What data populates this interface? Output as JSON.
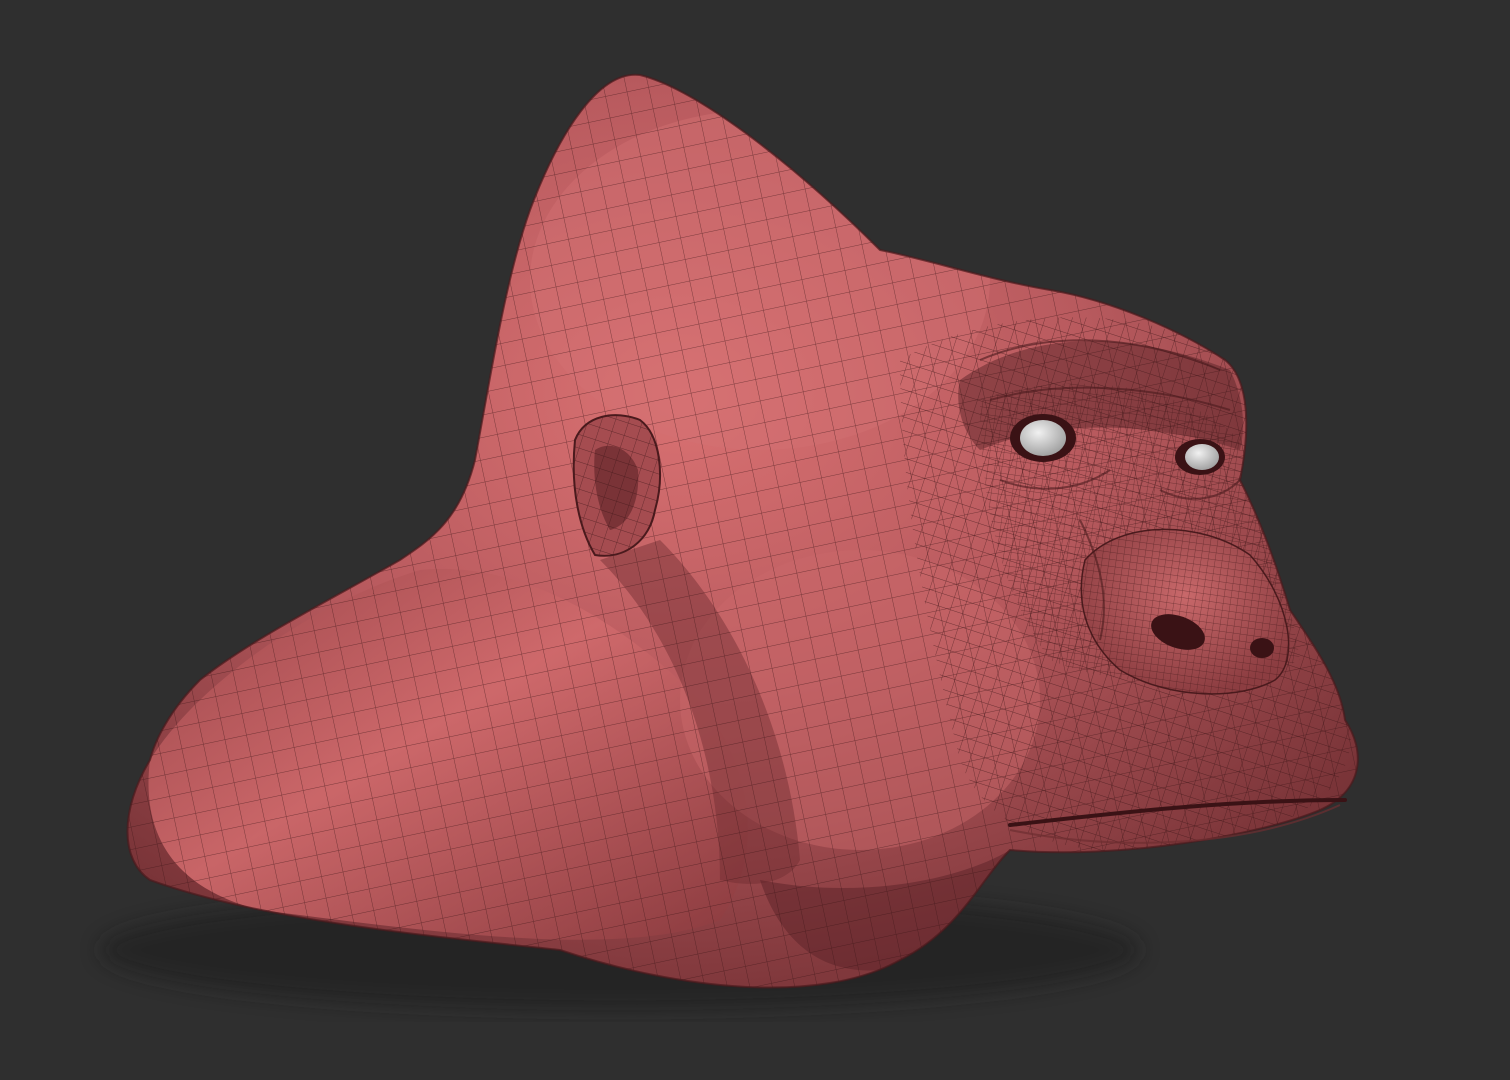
{
  "viewport": {
    "background_color": "#2f2f2f"
  },
  "model": {
    "subject": "gorilla-head-bust",
    "render_style": "wireframe-on-shaded-clay",
    "clay_color_mid": "#b85a5e",
    "clay_color_light": "#d97172",
    "clay_color_dark": "#6e2d31",
    "wire_color": "#3a1416",
    "eye_color": "#d6d6d6"
  }
}
